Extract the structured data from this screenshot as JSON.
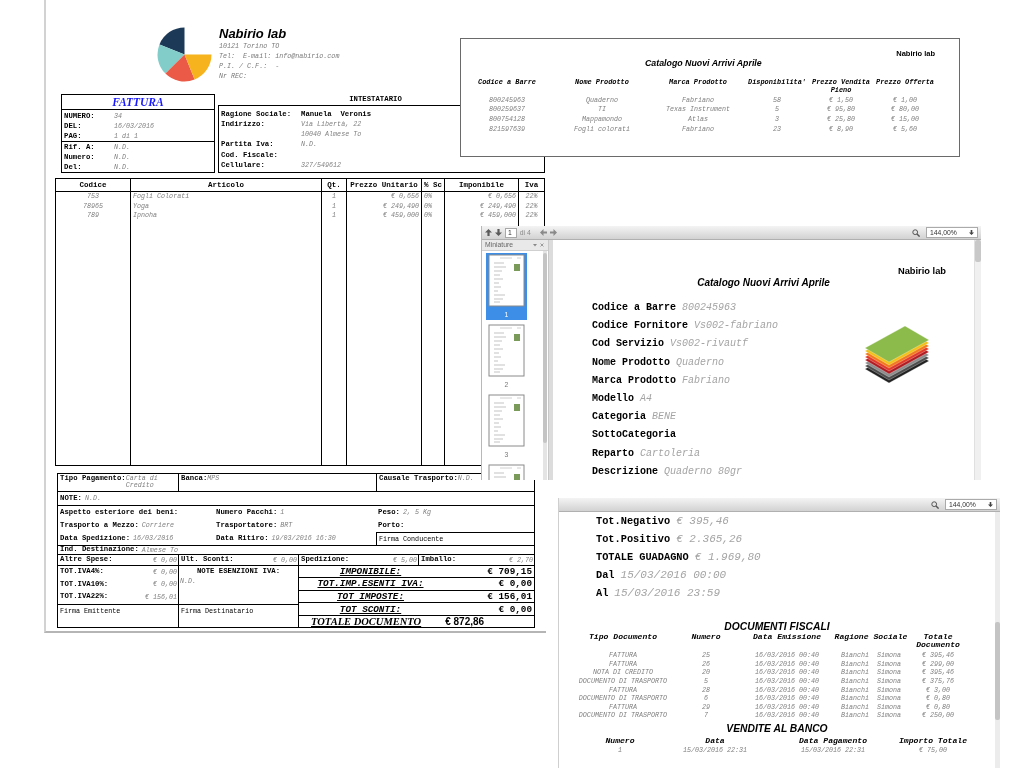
{
  "invoice": {
    "company": {
      "name": "Nabirio lab",
      "lines": [
        "10121 Torino TO",
        "Tel:  E-mail: info@nabirio.com",
        "P.I. / C.F.:  -",
        "Nr REC:"
      ]
    },
    "document": {
      "title": "FATTURA",
      "fields": [
        {
          "label": "NUMERO:",
          "value": "34"
        },
        {
          "label": "DEL:",
          "value": "16/03/2016"
        },
        {
          "label": "PAG:",
          "value": "1 di 1"
        }
      ],
      "references": [
        {
          "label": "Rif. A:",
          "value": "N.D."
        },
        {
          "label": "Numero:",
          "value": "N.D."
        },
        {
          "label": "Del:",
          "value": "N.D."
        }
      ]
    },
    "customer": {
      "title": "INTESTATARIO",
      "fields": [
        {
          "label": "Ragione Sociale:",
          "kind": "name",
          "values": [
            "Manuela  Veronis"
          ]
        },
        {
          "label": "Indirizzo:",
          "kind": "plain",
          "values": [
            "Via Libertà, 22",
            "10040 Almese To"
          ]
        },
        {
          "label": "Partita Iva:",
          "kind": "plain",
          "values": [
            "N.D."
          ]
        },
        {
          "label": "Cod. Fiscale:"
        },
        {
          "label": "Cellulare:",
          "kind": "plain",
          "values": [
            "327/549612"
          ]
        }
      ]
    },
    "items": {
      "columns": [
        "Codice",
        "Articolo",
        "Qt.",
        "Prezzo Unitario",
        "% Sc",
        "Imponibile",
        "Iva"
      ],
      "rows": [
        [
          "753",
          "Fogli Colorati",
          "1",
          "€ 0,656",
          "0%",
          "€ 0,656",
          "22%"
        ],
        [
          "78965",
          "Yoga",
          "1",
          "€ 249,490",
          "0%",
          "€ 249,490",
          "22%"
        ],
        [
          "789",
          "Ipnoha",
          "1",
          "€ 459,000",
          "0%",
          "€ 459,000",
          "22%"
        ]
      ]
    },
    "payment": [
      {
        "label": "Tipo Pagamento:",
        "value": "Carta di Credito"
      },
      {
        "label": "Banca:",
        "value": "MPS"
      },
      {
        "label": "Causale Trasporto:",
        "value": "N.D."
      }
    ],
    "notes": {
      "label": "NOTE:",
      "value": "N.D."
    },
    "shipping": [
      [
        {
          "label": "Aspetto esteriore dei beni:"
        },
        {
          "label": "Numero Pacchi:",
          "value": "1"
        },
        {
          "label": "Peso:",
          "value": "2, 5 Kg"
        }
      ],
      [
        {
          "label": "Trasporto a Mezzo:",
          "value": "Corriere"
        },
        {
          "label": "Trasportatore:",
          "value": "BRT"
        },
        {
          "label": "Porto:"
        }
      ],
      [
        {
          "label": "Data Spedizione:",
          "value": "16/03/2016"
        },
        {
          "label": "Data Ritiro:",
          "value": "19/03/2016 16:30"
        }
      ]
    ],
    "driver_signature": "Firma Conducente",
    "destination": {
      "label": "Ind. Destinazione:",
      "value": "Almese To"
    },
    "charges": [
      {
        "label": "Altre Spese:",
        "value": "€ 0,00"
      },
      {
        "label": "Ult. Sconti:",
        "value": "€ 0,00"
      },
      {
        "label": "Spedizione:",
        "value": "€ 5,00"
      },
      {
        "label": "Imballo:",
        "value": "€ 2,70"
      }
    ],
    "vat": [
      {
        "label": "TOT.IVA4%:",
        "value": "€ 0,00"
      },
      {
        "label": "TOT.IVA10%:",
        "value": "€ 0,00"
      },
      {
        "label": "TOT.IVA22%:",
        "value": "€ 156,01"
      }
    ],
    "vat_exemption": {
      "title": "NOTE ESENZIONI IVA:",
      "value": "N.D."
    },
    "signatures": [
      "Firma Emittente",
      "Firma Destinatario"
    ],
    "totals": [
      {
        "label": "IMPONIBILE:",
        "value": "€ 709,15"
      },
      {
        "label": "TOT.IMP.ESENTI IVA:",
        "value": "€ 0,00"
      },
      {
        "label": "TOT IMPOSTE:",
        "value": "€ 156,01"
      },
      {
        "label": "TOT SCONTI:",
        "value": "€ 0,00"
      }
    ],
    "grand_total": {
      "label": "TOTALE DOCUMENTO",
      "value": "€ 872,86"
    }
  },
  "catalog_list": {
    "company": "Nabirio lab",
    "title": "Catalogo Nuovi Arrivi Aprile",
    "columns": [
      "Codice a Barre",
      "Nome Prodotto",
      "Marca Prodotto",
      "Disponibilita'",
      "Prezzo Vendita Pieno",
      "Prezzo Offerta"
    ],
    "rows": [
      [
        "800245963",
        "Quaderno",
        "Fabriano",
        "58",
        "€ 1,50",
        "€ 1,00"
      ],
      [
        "800259637",
        "TI",
        "Texas Instrument",
        "5",
        "€ 95,80",
        "€ 80,00"
      ],
      [
        "800754128",
        "Mappamondo",
        "Atlas",
        "3",
        "€ 25,80",
        "€ 15,00"
      ],
      [
        "821597639",
        "Fogli colorati",
        "Fabriano",
        "23",
        "€ 8,90",
        "€ 5,60"
      ]
    ]
  },
  "pdf_viewer": {
    "toolbar": {
      "page": "1",
      "page_count": "di 4",
      "zoom": "144,00%"
    },
    "sidebar": {
      "title": "Miniature",
      "thumbnails": [
        {
          "label": "1",
          "selected": true
        },
        {
          "label": "2",
          "selected": false
        },
        {
          "label": "3",
          "selected": false
        },
        {
          "selected": false
        }
      ]
    },
    "page": {
      "company": "Nabirio lab",
      "title": "Catalogo Nuovi Arrivi Aprile",
      "fields": [
        {
          "label": "Codice a Barre",
          "value": "800245963"
        },
        {
          "label": "Codice Fornitore",
          "value": "Vs002-fabriano"
        },
        {
          "label": "Cod Servizio",
          "value": "Vs002-rivautf"
        },
        {
          "label": "Nome Prodotto",
          "value": "Quaderno"
        },
        {
          "label": "Marca Prodotto",
          "value": "Fabriano"
        },
        {
          "label": "Modello",
          "value": "A4"
        },
        {
          "label": "Categoria",
          "value": "BENE"
        },
        {
          "label": "SottoCategoria"
        },
        {
          "label": "Reparto",
          "value": "Cartoleria"
        },
        {
          "label": "Descrizione",
          "value": "Quaderno 80gr"
        }
      ]
    }
  },
  "report_viewer": {
    "toolbar": {
      "zoom": "144,00%"
    },
    "summary": [
      {
        "label": "Tot.Negativo",
        "value": "€ 395,46"
      },
      {
        "label": "Tot.Positivo",
        "value": "€ 2.365,26"
      },
      {
        "label": "TOTALE GUADAGNO",
        "value": "€ 1.969,80"
      },
      {
        "label": "Dal",
        "value": "15/03/2016 00:00"
      },
      {
        "label": "Al",
        "value": "15/03/2016 23:59"
      }
    ],
    "fiscal_documents": {
      "title": "DOCUMENTI FISCALI",
      "columns": [
        "Tipo Documento",
        "Numero",
        "Data Emissione",
        "Ragione Sociale",
        "Totale Documento"
      ],
      "rows": [
        [
          "FATTURA",
          "25",
          "16/03/2016 00:40",
          "Bianchi  Simona",
          "€ 395,46"
        ],
        [
          "FATTURA",
          "26",
          "16/03/2016 00:40",
          "Bianchi  Simona",
          "€ 299,00"
        ],
        [
          "NOTA DI CREDITO",
          "20",
          "16/03/2016 00:40",
          "Bianchi  Simona",
          "€ 395,46"
        ],
        [
          "DOCUMENTO DI TRASPORTO",
          "5",
          "16/03/2016 00:40",
          "Bianchi  Simona",
          "€ 375,76"
        ],
        [
          "FATTURA",
          "28",
          "16/03/2016 00:40",
          "Bianchi  Simona",
          "€ 3,00"
        ],
        [
          "DOCUMENTO DI TRASPORTO",
          "6",
          "16/03/2016 00:40",
          "Bianchi  Simona",
          "€ 0,80"
        ],
        [
          "FATTURA",
          "29",
          "16/03/2016 00:40",
          "Bianchi  Simona",
          "€ 0,80"
        ],
        [
          "DOCUMENTO DI TRASPORTO",
          "7",
          "16/03/2016 00:40",
          "Bianchi  Simona",
          "€ 250,00"
        ]
      ]
    },
    "counter_sales": {
      "title": "VENDITE AL BANCO",
      "columns": [
        "Numero",
        "Data",
        "Data Pagamento",
        "Importo Totale"
      ],
      "rows": [
        [
          "1",
          "15/03/2016 22:31",
          "15/03/2016 22:31",
          "€ 75,00"
        ]
      ]
    }
  }
}
